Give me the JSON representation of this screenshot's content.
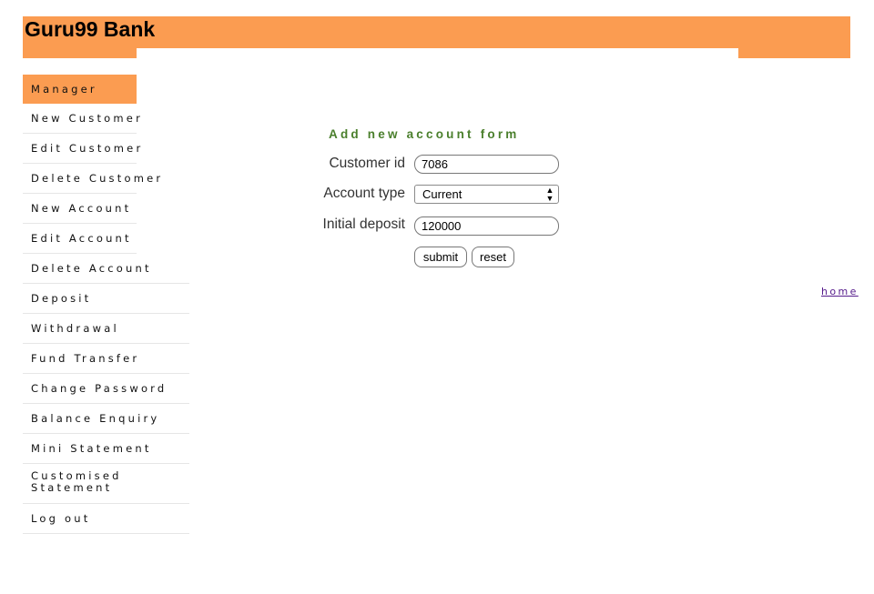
{
  "header": {
    "title": "Guru99 Bank",
    "color": "#FB9C51"
  },
  "sidebar": {
    "items": [
      {
        "label": "Manager",
        "active": true
      },
      {
        "label": "New Customer"
      },
      {
        "label": "Edit Customer"
      },
      {
        "label": "Delete Customer"
      },
      {
        "label": "New Account"
      },
      {
        "label": "Edit Account"
      },
      {
        "label": "Delete Account"
      },
      {
        "label": "Deposit"
      },
      {
        "label": "Withdrawal"
      },
      {
        "label": "Fund Transfer"
      },
      {
        "label": "Change Password"
      },
      {
        "label": "Balance Enquiry"
      },
      {
        "label": "Mini Statement"
      },
      {
        "label": "Customised Statement"
      },
      {
        "label": "Log out"
      }
    ]
  },
  "form": {
    "title": "Add new account form",
    "title_color": "#4A7F2C",
    "customer_id_label": "Customer id",
    "customer_id_value": "7086",
    "account_type_label": "Account type",
    "account_type_value": "Current",
    "initial_deposit_label": "Initial deposit",
    "initial_deposit_value": "120000",
    "submit_label": "submit",
    "reset_label": "reset"
  },
  "home_link": "home"
}
